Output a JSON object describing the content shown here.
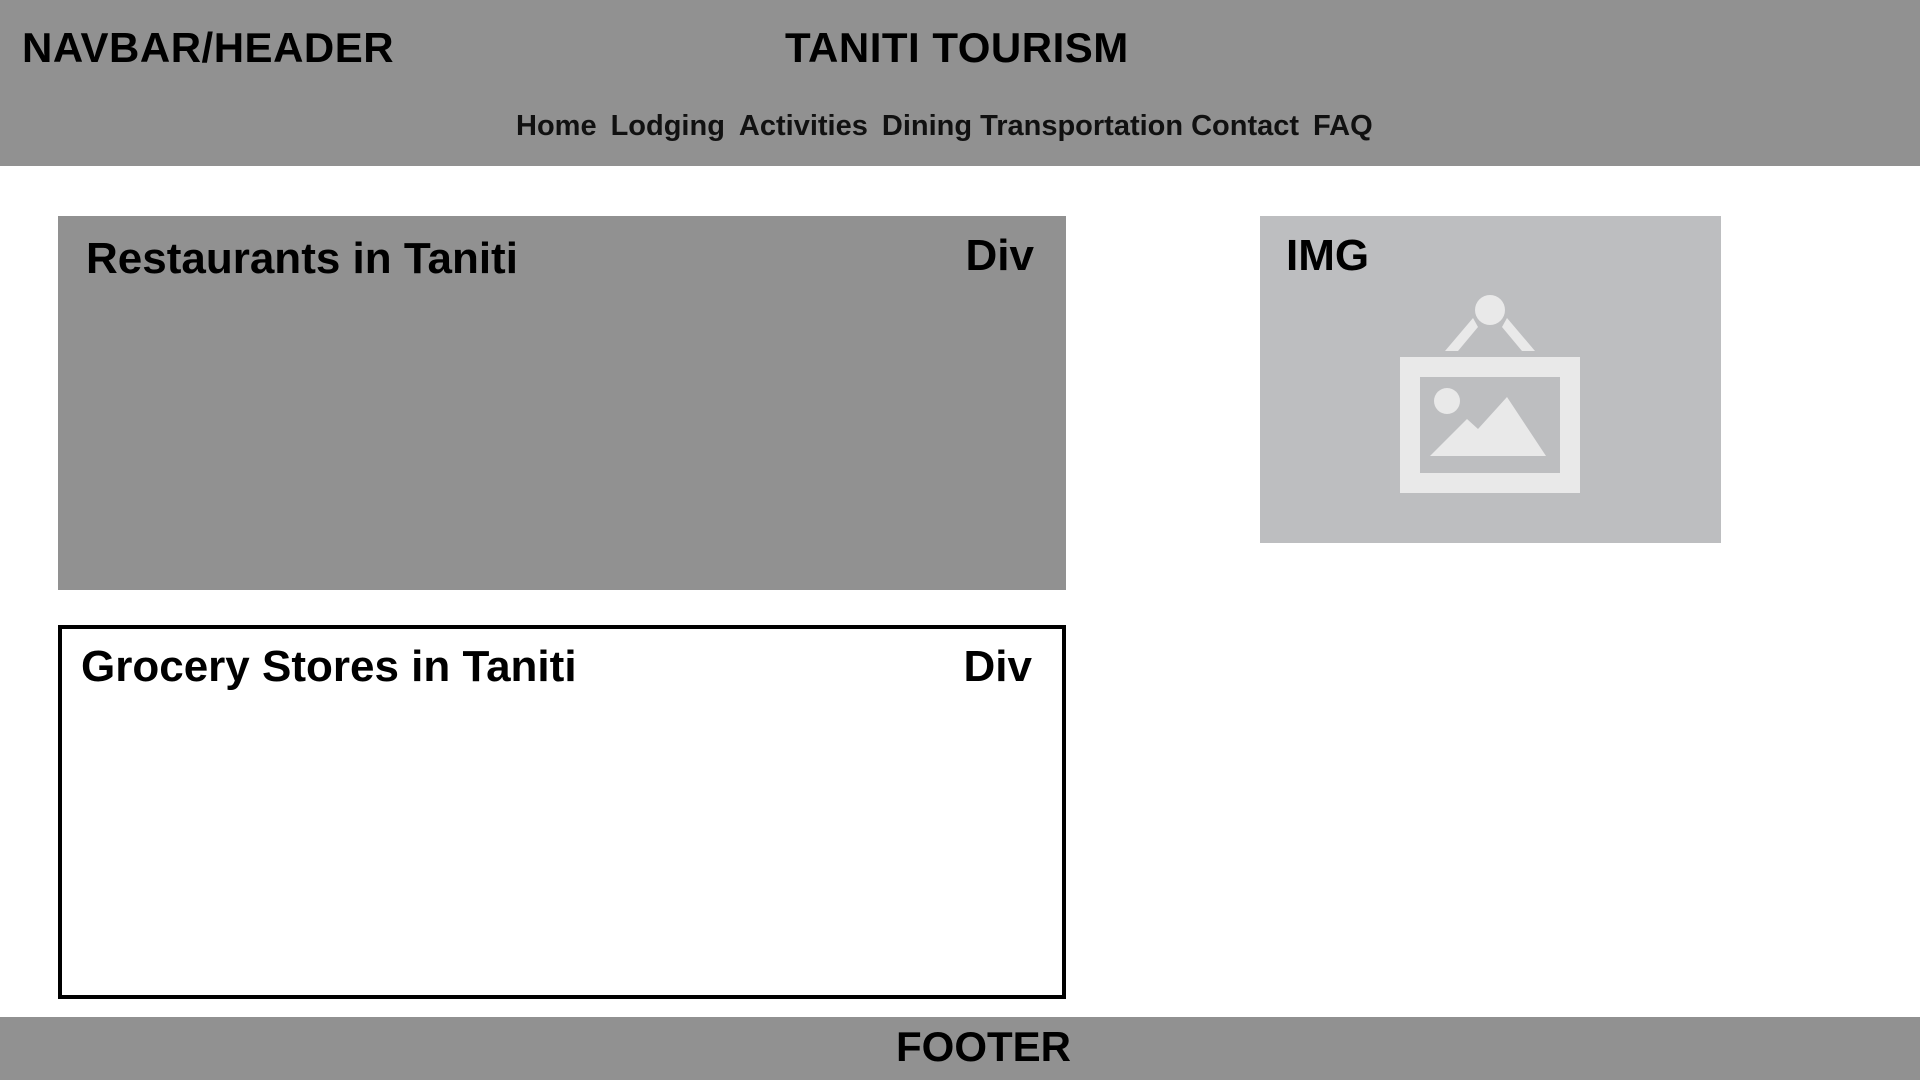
{
  "header": {
    "label": "NAVBAR/HEADER",
    "site_title": "TANITI TOURISM",
    "nav": [
      {
        "label": "Home"
      },
      {
        "label": "Lodging"
      },
      {
        "label": "Activities"
      },
      {
        "label": "Dining"
      },
      {
        "label": "Transportation"
      },
      {
        "label": "Contact"
      },
      {
        "label": "FAQ"
      }
    ]
  },
  "main": {
    "restaurants": {
      "title": "Restaurants in Taniti",
      "tag": "Div"
    },
    "grocery": {
      "title": "Grocery Stores in Taniti",
      "tag": "Div"
    },
    "image": {
      "label": "IMG",
      "icon": "image-placeholder-icon"
    }
  },
  "footer": {
    "label": "FOOTER"
  },
  "colors": {
    "header_bg": "#919191",
    "panel_bg": "#919191",
    "image_bg": "#bdbec0",
    "icon_fill": "#e9e9e9",
    "text": "#000000"
  }
}
